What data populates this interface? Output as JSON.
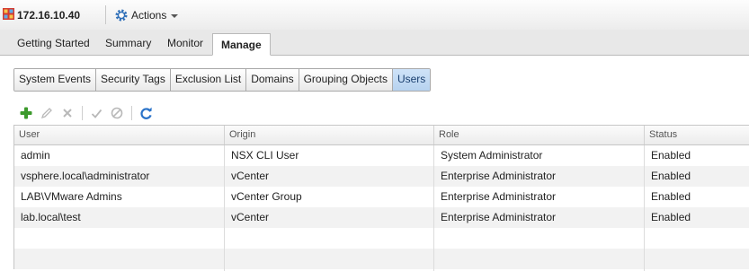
{
  "window": {
    "host_title": "172.16.10.40",
    "host_icon": "host-grid-icon",
    "actions_label": "Actions",
    "actions_icon": "gear-icon"
  },
  "main_tabs": [
    {
      "label": "Getting Started",
      "active": false
    },
    {
      "label": "Summary",
      "active": false
    },
    {
      "label": "Monitor",
      "active": false
    },
    {
      "label": "Manage",
      "active": true
    }
  ],
  "sub_tabs": [
    {
      "label": "System Events",
      "selected": false
    },
    {
      "label": "Security Tags",
      "selected": false
    },
    {
      "label": "Exclusion List",
      "selected": false
    },
    {
      "label": "Domains",
      "selected": false
    },
    {
      "label": "Grouping Objects",
      "selected": false
    },
    {
      "label": "Users",
      "selected": true
    }
  ],
  "toolbar": {
    "buttons": [
      {
        "icon": "add-icon",
        "enabled": true
      },
      {
        "icon": "edit-pencil-icon",
        "enabled": false
      },
      {
        "icon": "delete-x-icon",
        "enabled": false
      },
      {
        "icon": "enable-check-icon",
        "enabled": false
      },
      {
        "icon": "disable-circle-icon",
        "enabled": false
      },
      {
        "icon": "refresh-icon",
        "enabled": true
      }
    ]
  },
  "users_table": {
    "columns": [
      "User",
      "Origin",
      "Role",
      "Status"
    ],
    "rows": [
      [
        "admin",
        "NSX CLI User",
        "System Administrator",
        "Enabled"
      ],
      [
        "vsphere.local\\administrator",
        "vCenter",
        "Enterprise Administrator",
        "Enabled"
      ],
      [
        "LAB\\VMware Admins",
        "vCenter Group",
        "Enterprise Administrator",
        "Enabled"
      ],
      [
        "lab.local\\test",
        "vCenter",
        "Enterprise Administrator",
        "Enabled"
      ]
    ]
  },
  "colors": {
    "add_green": "#3c9a2c",
    "refresh_blue": "#2a73c9",
    "selected_subtab": "#c4dcf5",
    "disabled_icon": "#b8b8b8"
  }
}
